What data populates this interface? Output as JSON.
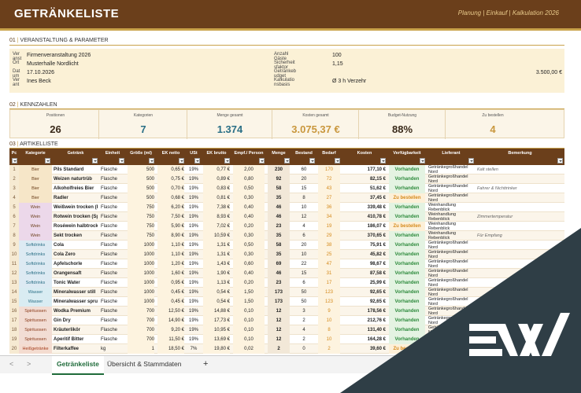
{
  "header": {
    "title": "GETRÄNKELISTE",
    "nav": "Planung | Einkauf | Kalkulation 2026"
  },
  "sections": {
    "s1": {
      "num": "01",
      "title": "VERANSTALTUNG & PARAMETER"
    },
    "s2": {
      "num": "02",
      "title": "KENNZAHLEN"
    },
    "s3": {
      "num": "03",
      "title": "ARTIKELLISTE"
    }
  },
  "params": {
    "left": [
      {
        "label": "Ver anst",
        "value": "Firmenveranstaltung 2026"
      },
      {
        "label": "Ort",
        "value": "Musterhalle Nordlicht"
      },
      {
        "label": "Dat um",
        "value": "17.10.2026"
      },
      {
        "label": "Ver ant",
        "value": "Ines Beck"
      }
    ],
    "right": [
      {
        "label": "Anzahl Gäste",
        "value": "100"
      },
      {
        "label": "Sicherheit sfaktor",
        "value": "1,15"
      },
      {
        "label": "Getränkeb udget",
        "value": "3.500,00 €"
      },
      {
        "label": "Kalkulatio nsbasis",
        "value": "Ø 3 h Verzehr"
      }
    ]
  },
  "kpis": [
    {
      "label": "Positionen",
      "value": "26",
      "color": "#3a2a1a"
    },
    {
      "label": "Kategorien",
      "value": "7",
      "color": "#2a6f86"
    },
    {
      "label": "Menge gesamt",
      "value": "1.374",
      "color": "#2a6f86"
    },
    {
      "label": "Kosten gesamt",
      "value": "3.075,37 €",
      "color": "#c9973d"
    },
    {
      "label": "Budget-Nutzung",
      "value": "88%",
      "color": "#3a2a1a"
    },
    {
      "label": "Zu bestellen",
      "value": "4",
      "color": "#c9973d"
    }
  ],
  "columns": [
    "Pc",
    "Kategorie",
    "Getränk",
    "Einheit",
    "Größe (ml)",
    "EK netto",
    "USt",
    "EK brutto",
    "Empf./ Person",
    "Menge",
    "Bestand",
    "Bedarf",
    "Kosten",
    "Verfügbarkeit",
    "Lieferant",
    "Bemerkung"
  ],
  "rows": [
    {
      "n": "1",
      "cat": "Bier",
      "name": "Pils Standard",
      "unit": "Flasche",
      "size": "500",
      "net": "0,65 €",
      "vat": "19%",
      "gross": "0,77 €",
      "pp": "2,00",
      "qty": "230",
      "stock": "60",
      "need": "170",
      "cost": "177,10 €",
      "avail": "Vorhanden",
      "sup": "Getränkegroßhandel Nord",
      "note": "Kalt stellen"
    },
    {
      "n": "2",
      "cat": "Bier",
      "name": "Weizen naturtrüb",
      "unit": "Flasche",
      "size": "500",
      "net": "0,75 €",
      "vat": "19%",
      "gross": "0,89 €",
      "pp": "0,80",
      "qty": "92",
      "stock": "20",
      "need": "72",
      "cost": "82,15 €",
      "avail": "Vorhanden",
      "sup": "Getränkegroßhandel Nord",
      "note": ""
    },
    {
      "n": "3",
      "cat": "Bier",
      "name": "Alkoholfreies Bier",
      "unit": "Flasche",
      "size": "500",
      "net": "0,70 €",
      "vat": "19%",
      "gross": "0,83 €",
      "pp": "0,50",
      "qty": "58",
      "stock": "15",
      "need": "43",
      "cost": "51,62 €",
      "avail": "Vorhanden",
      "sup": "Getränkegroßhandel Nord",
      "note": "Fahrer & Nichttrinker"
    },
    {
      "n": "4",
      "cat": "Bier",
      "name": "Radler",
      "unit": "Flasche",
      "size": "500",
      "net": "0,68 €",
      "vat": "19%",
      "gross": "0,81 €",
      "pp": "0,30",
      "qty": "35",
      "stock": "8",
      "need": "27",
      "cost": "37,45 €",
      "avail": "Zu bestellen",
      "sup": "Getränkegroßhandel Nord",
      "note": ""
    },
    {
      "n": "5",
      "cat": "Wein",
      "name": "Weißwein trocken (Riesling)",
      "unit": "Flasche",
      "size": "750",
      "net": "6,20 €",
      "vat": "19%",
      "gross": "7,38 €",
      "pp": "0,40",
      "qty": "46",
      "stock": "10",
      "need": "36",
      "cost": "339,48 €",
      "avail": "Vorhanden",
      "sup": "Weinhandlung Rebenblick",
      "note": ""
    },
    {
      "n": "6",
      "cat": "Wein",
      "name": "Rotwein trocken (Spätburgunder)",
      "unit": "Flasche",
      "size": "750",
      "net": "7,50 €",
      "vat": "19%",
      "gross": "8,93 €",
      "pp": "0,40",
      "qty": "46",
      "stock": "12",
      "need": "34",
      "cost": "410,78 €",
      "avail": "Vorhanden",
      "sup": "Weinhandlung Rebenblick",
      "note": "Zimmertemperatur"
    },
    {
      "n": "7",
      "cat": "Wein",
      "name": "Roséwein halbtrocken",
      "unit": "Flasche",
      "size": "750",
      "net": "5,90 €",
      "vat": "19%",
      "gross": "7,02 €",
      "pp": "0,20",
      "qty": "23",
      "stock": "4",
      "need": "19",
      "cost": "186,07 €",
      "avail": "Zu bestellen",
      "sup": "Weinhandlung Rebenblick",
      "note": ""
    },
    {
      "n": "8",
      "cat": "Wein",
      "name": "Sekt trocken",
      "unit": "Flasche",
      "size": "750",
      "net": "8,90 €",
      "vat": "19%",
      "gross": "10,59 €",
      "pp": "0,30",
      "qty": "35",
      "stock": "6",
      "need": "29",
      "cost": "370,65 €",
      "avail": "Vorhanden",
      "sup": "Weinhandlung Rebenblick",
      "note": "Für Empfang"
    },
    {
      "n": "9",
      "cat": "Softdrinks",
      "name": "Cola",
      "unit": "Flasche",
      "size": "1000",
      "net": "1,10 €",
      "vat": "19%",
      "gross": "1,31 €",
      "pp": "0,50",
      "qty": "58",
      "stock": "20",
      "need": "38",
      "cost": "75,91 €",
      "avail": "Vorhanden",
      "sup": "Getränkegroßhandel Nord",
      "note": ""
    },
    {
      "n": "10",
      "cat": "Softdrinks",
      "name": "Cola Zero",
      "unit": "Flasche",
      "size": "1000",
      "net": "1,10 €",
      "vat": "19%",
      "gross": "1,31 €",
      "pp": "0,30",
      "qty": "35",
      "stock": "10",
      "need": "25",
      "cost": "45,82 €",
      "avail": "Vorhanden",
      "sup": "Getränkegroßhandel Nord",
      "note": ""
    },
    {
      "n": "11",
      "cat": "Softdrinks",
      "name": "Apfelschorle",
      "unit": "Flasche",
      "size": "1000",
      "net": "1,20 €",
      "vat": "19%",
      "gross": "1,43 €",
      "pp": "0,60",
      "qty": "69",
      "stock": "22",
      "need": "47",
      "cost": "98,67 €",
      "avail": "Vorhanden",
      "sup": "Getränkegroßhandel Nord",
      "note": ""
    },
    {
      "n": "12",
      "cat": "Softdrinks",
      "name": "Orangensaft",
      "unit": "Flasche",
      "size": "1000",
      "net": "1,60 €",
      "vat": "19%",
      "gross": "1,90 €",
      "pp": "0,40",
      "qty": "46",
      "stock": "15",
      "need": "31",
      "cost": "87,58 €",
      "avail": "Vorhanden",
      "sup": "Getränkegroßhandel Nord",
      "note": ""
    },
    {
      "n": "13",
      "cat": "Softdrinks",
      "name": "Tonic Water",
      "unit": "Flasche",
      "size": "1000",
      "net": "0,95 €",
      "vat": "19%",
      "gross": "1,13 €",
      "pp": "0,20",
      "qty": "23",
      "stock": "6",
      "need": "17",
      "cost": "25,99 €",
      "avail": "Vorhanden",
      "sup": "Getränkegroßhandel Nord",
      "note": ""
    },
    {
      "n": "14",
      "cat": "Wasser",
      "name": "Mineralwasser still",
      "unit": "Flasche",
      "size": "1000",
      "net": "0,45 €",
      "vat": "19%",
      "gross": "0,54 €",
      "pp": "1,50",
      "qty": "173",
      "stock": "50",
      "need": "123",
      "cost": "92,65 €",
      "avail": "Vorhanden",
      "sup": "Getränkegroßhandel Nord",
      "note": ""
    },
    {
      "n": "15",
      "cat": "Wasser",
      "name": "Mineralwasser sprudelnd",
      "unit": "Flasche",
      "size": "1000",
      "net": "0,45 €",
      "vat": "19%",
      "gross": "0,54 €",
      "pp": "1,50",
      "qty": "173",
      "stock": "50",
      "need": "123",
      "cost": "92,65 €",
      "avail": "Vorhanden",
      "sup": "Getränkegroßhandel Nord",
      "note": ""
    },
    {
      "n": "16",
      "cat": "Spirituosen",
      "name": "Wodka Premium",
      "unit": "Flasche",
      "size": "700",
      "net": "12,50 €",
      "vat": "19%",
      "gross": "14,88 €",
      "pp": "0,10",
      "qty": "12",
      "stock": "3",
      "need": "9",
      "cost": "178,56 €",
      "avail": "Vorhanden",
      "sup": "Getränkegroßhandel Nord",
      "note": ""
    },
    {
      "n": "17",
      "cat": "Spirituosen",
      "name": "Gin Dry",
      "unit": "Flasche",
      "size": "700",
      "net": "14,90 €",
      "vat": "19%",
      "gross": "17,73 €",
      "pp": "0,10",
      "qty": "12",
      "stock": "2",
      "need": "10",
      "cost": "212,76 €",
      "avail": "Vorhanden",
      "sup": "Getränkegroßhandel Nord",
      "note": ""
    },
    {
      "n": "18",
      "cat": "Spirituosen",
      "name": "Kräuterlikör",
      "unit": "Flasche",
      "size": "700",
      "net": "9,20 €",
      "vat": "19%",
      "gross": "10,95 €",
      "pp": "0,10",
      "qty": "12",
      "stock": "4",
      "need": "8",
      "cost": "131,40 €",
      "avail": "Vorhanden",
      "sup": "Getränkegroßhandel Nord",
      "note": ""
    },
    {
      "n": "19",
      "cat": "Spirituosen",
      "name": "Aperitif Bitter",
      "unit": "Flasche",
      "size": "700",
      "net": "11,50 €",
      "vat": "19%",
      "gross": "13,69 €",
      "pp": "0,10",
      "qty": "12",
      "stock": "2",
      "need": "10",
      "cost": "164,28 €",
      "avail": "Vorhanden",
      "sup": "Getränkegroßhandel Nord",
      "note": ""
    },
    {
      "n": "20",
      "cat": "Heißgetränke",
      "name": "Filterkaffee",
      "unit": "kg",
      "size": "1",
      "net": "18,50 €",
      "vat": "7%",
      "gross": "19,80 €",
      "pp": "0,02",
      "qty": "2",
      "stock": "0",
      "need": "2",
      "cost": "39,60 €",
      "avail": "Zu bestellen",
      "sup": "Getränkegroßhandel Nord",
      "note": ""
    }
  ],
  "tabs": {
    "prev": "<",
    "next": ">",
    "active": "Getränkeliste",
    "second": "Übersicht & Stammdaten",
    "add": "+"
  },
  "watermark": {
    "text": "EW"
  },
  "colors": {
    "brown": "#6b3f1b",
    "gold": "#c9a24a",
    "green": "#2e8b3d",
    "orange": "#d58a1c"
  }
}
